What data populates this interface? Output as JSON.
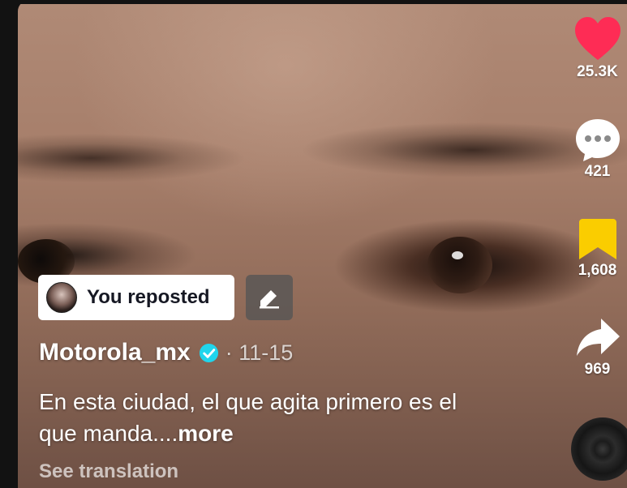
{
  "actions": {
    "likes": "25.3K",
    "comments": "421",
    "favorites": "1,608",
    "shares": "969"
  },
  "repost": {
    "label": "You reposted"
  },
  "post": {
    "author": "Motorola_mx",
    "date": "· 11-15",
    "caption_line1": "En esta ciudad, el que agita primero es el",
    "caption_line2": "que manda....",
    "more_label": "more",
    "translate_label": "See translation"
  },
  "icons": {
    "like": "heart-icon",
    "comment": "comment-bubble-icon",
    "favorite": "bookmark-icon",
    "share": "share-arrow-icon",
    "edit": "pencil-icon",
    "verified": "verified-badge-icon",
    "sound": "music-disc-icon"
  },
  "colors": {
    "like": "#fe2c55",
    "favorite": "#facd00",
    "verified": "#20d5ec"
  }
}
